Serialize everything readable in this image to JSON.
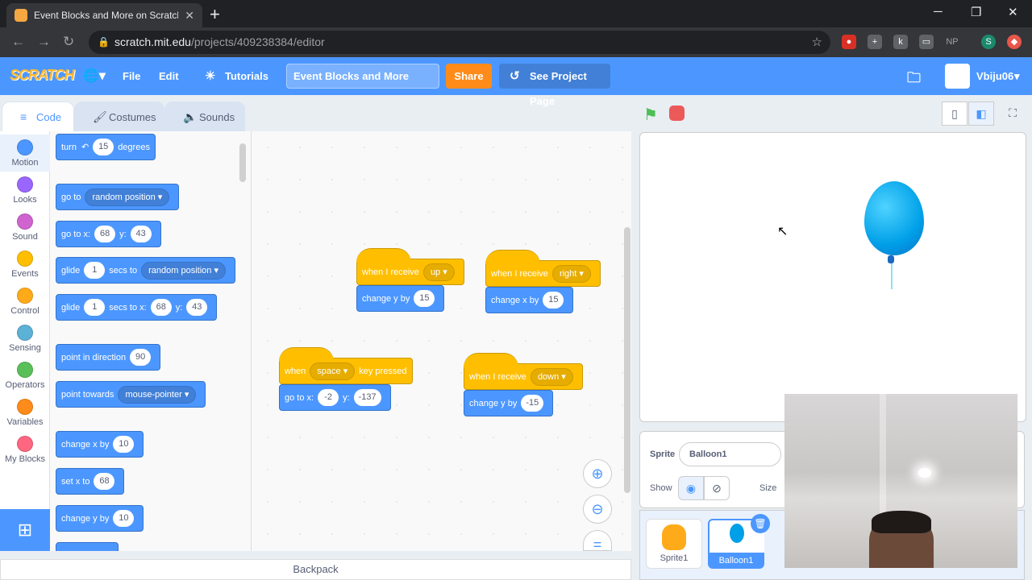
{
  "browser": {
    "tab_title": "Event Blocks and More on Scratch",
    "url_host": "scratch.mit.edu",
    "url_path": "/projects/409238384/editor",
    "extension_np": "NP",
    "profile_initial": "S"
  },
  "menubar": {
    "logo": "SCRATCH",
    "file": "File",
    "edit": "Edit",
    "tutorials": "Tutorials",
    "project_title": "Event Blocks and More",
    "share": "Share",
    "see_project_page": "See Project Page",
    "username": "Vbiju06"
  },
  "tabs": {
    "code": "Code",
    "costumes": "Costumes",
    "sounds": "Sounds"
  },
  "categories": [
    {
      "label": "Motion",
      "color": "#4c97ff"
    },
    {
      "label": "Looks",
      "color": "#9966ff"
    },
    {
      "label": "Sound",
      "color": "#cf63cf"
    },
    {
      "label": "Events",
      "color": "#ffbf00"
    },
    {
      "label": "Control",
      "color": "#ffab19"
    },
    {
      "label": "Sensing",
      "color": "#5cb1d6"
    },
    {
      "label": "Operators",
      "color": "#59c059"
    },
    {
      "label": "Variables",
      "color": "#ff8c1a"
    },
    {
      "label": "My Blocks",
      "color": "#ff6680"
    }
  ],
  "palette": {
    "turn_label": "turn",
    "turn_val": "15",
    "turn_unit": "degrees",
    "goto_label": "go to",
    "goto_dd": "random position",
    "gotoxy_label": "go to x:",
    "gotoxy_x": "68",
    "gotoxy_y_label": "y:",
    "gotoxy_y": "43",
    "glide1_label": "glide",
    "glide1_val": "1",
    "glide1_mid": "secs to",
    "glide1_dd": "random position",
    "glide2_label": "glide",
    "glide2_val": "1",
    "glide2_mid": "secs to x:",
    "glide2_x": "68",
    "glide2_y_label": "y:",
    "glide2_y": "43",
    "point_dir_label": "point in direction",
    "point_dir_val": "90",
    "point_towards_label": "point towards",
    "point_towards_dd": "mouse-pointer",
    "changex_label": "change x by",
    "changex_val": "10",
    "setx_label": "set x to",
    "setx_val": "68",
    "changey_label": "change y by",
    "changey_val": "10"
  },
  "scripts": {
    "s1": {
      "hat": "when I receive",
      "msg": "up",
      "body": "change y by",
      "val": "15"
    },
    "s2": {
      "hat": "when I receive",
      "msg": "right",
      "body": "change x by",
      "val": "15"
    },
    "s3": {
      "hat_pre": "when",
      "key": "space",
      "hat_post": "key pressed",
      "body": "go to x:",
      "x": "-2",
      "y_label": "y:",
      "y": "-137"
    },
    "s4": {
      "hat": "when I receive",
      "msg": "down",
      "body": "change y by",
      "val": "-15"
    }
  },
  "backpack": "Backpack",
  "sprite_info": {
    "sprite_label": "Sprite",
    "sprite_name": "Balloon1",
    "show_label": "Show",
    "size_label": "Size"
  },
  "sprites": [
    "Sprite1",
    "Balloon1"
  ]
}
